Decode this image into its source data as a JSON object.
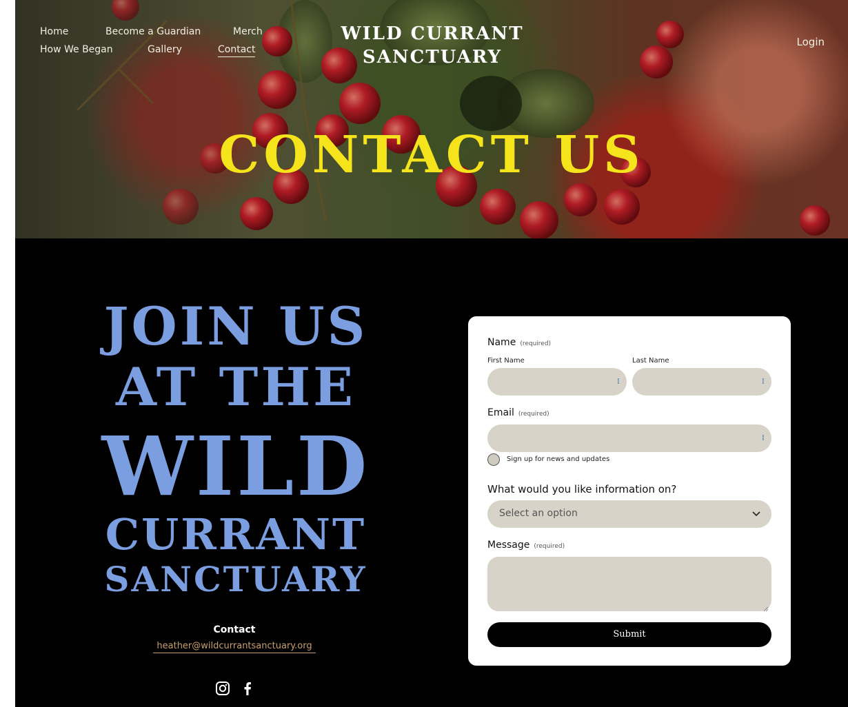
{
  "nav": {
    "items": [
      {
        "label": "Home",
        "active": false
      },
      {
        "label": "Become a Guardian",
        "active": false
      },
      {
        "label": "Merch",
        "active": false
      },
      {
        "label": "How We Began",
        "active": false
      },
      {
        "label": "Gallery",
        "active": false
      },
      {
        "label": "Contact",
        "active": true
      }
    ],
    "login": "Login"
  },
  "brand": {
    "line1": "WILD CURRANT",
    "line2": "SANCTUARY"
  },
  "hero": {
    "title": "CONTACT US"
  },
  "join": {
    "line1": "JOIN US",
    "line2": "AT THE",
    "line3": "WILD",
    "line4": "CURRANT",
    "line5": "SANCTUARY"
  },
  "contact": {
    "label": "Contact",
    "email": "heather@wildcurrantsanctuary.org"
  },
  "socials": [
    "instagram-icon",
    "facebook-icon"
  ],
  "form": {
    "name_label": "Name",
    "required": "(required)",
    "first_name_label": "First Name",
    "last_name_label": "Last Name",
    "email_label": "Email",
    "newsletter_label": "Sign up for news and updates",
    "info_label": "What would you like information on?",
    "select_placeholder": "Select an option",
    "message_label": "Message",
    "submit_label": "Submit"
  },
  "colors": {
    "hero_title": "#f5e31b",
    "join_text": "#7b9ee0",
    "email_link": "#c8a06e",
    "field_bg": "#d7d3c8",
    "page_bg": "#000000"
  }
}
